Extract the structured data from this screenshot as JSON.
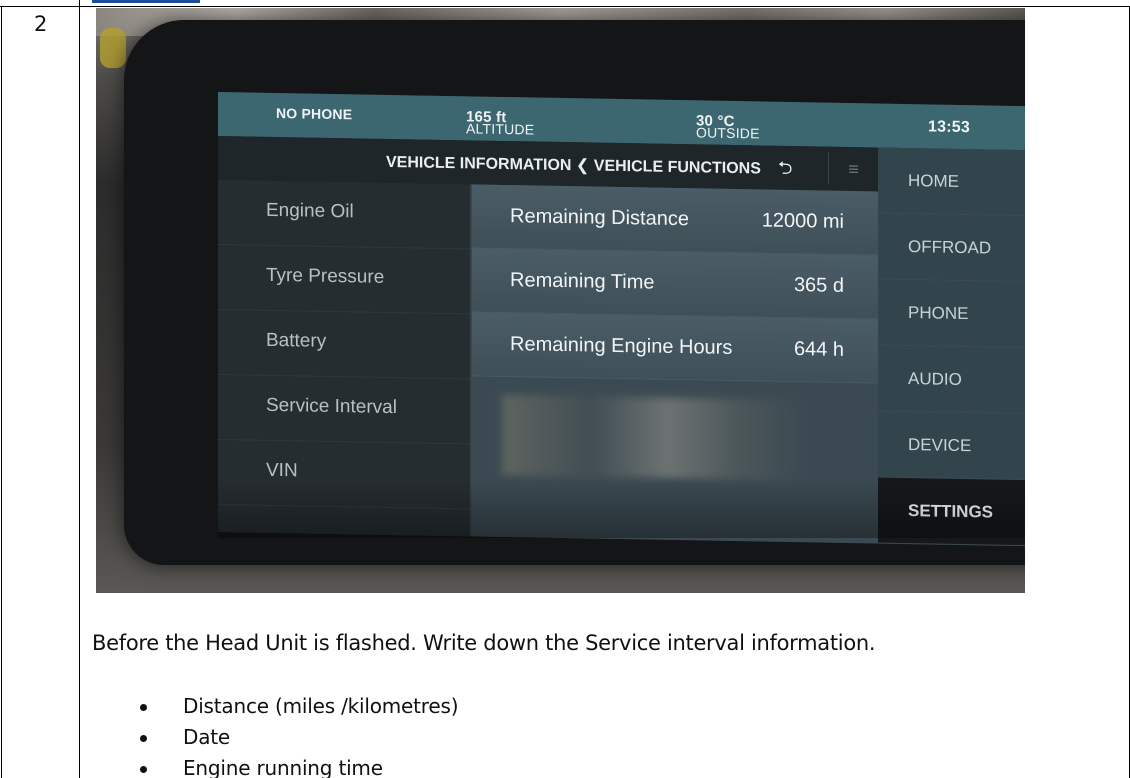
{
  "step_number": "2",
  "head_unit": {
    "status_bar": {
      "phone": "NO PHONE",
      "altitude_label": "ALTITUDE",
      "altitude_value": "165 ft",
      "outside_label": "OUTSIDE",
      "outside_value": "30 °C",
      "time": "13:53"
    },
    "breadcrumb": {
      "path": "VEHICLE INFORMATION ❮ VEHICLE FUNCTIONS",
      "back_icon": "return-arrow-icon",
      "menu_icon": "hamburger-icon"
    },
    "left_menu": [
      "Engine Oil",
      "Tyre Pressure",
      "Battery",
      "Service Interval",
      "VIN"
    ],
    "details": [
      {
        "label": "Remaining Distance",
        "value": "12000 mi"
      },
      {
        "label": "Remaining Time",
        "value": "365 d"
      },
      {
        "label": "Remaining Engine Hours",
        "value": "644 h"
      }
    ],
    "nav": [
      "HOME",
      "OFFROAD",
      "PHONE",
      "AUDIO",
      "DEVICE",
      "SETTINGS"
    ],
    "active_nav": "SETTINGS"
  },
  "instruction": "Before the Head Unit is flashed. Write down the Service interval information.",
  "bullets": [
    "Distance (miles /kilometres)",
    "Date",
    "Engine running time"
  ]
}
